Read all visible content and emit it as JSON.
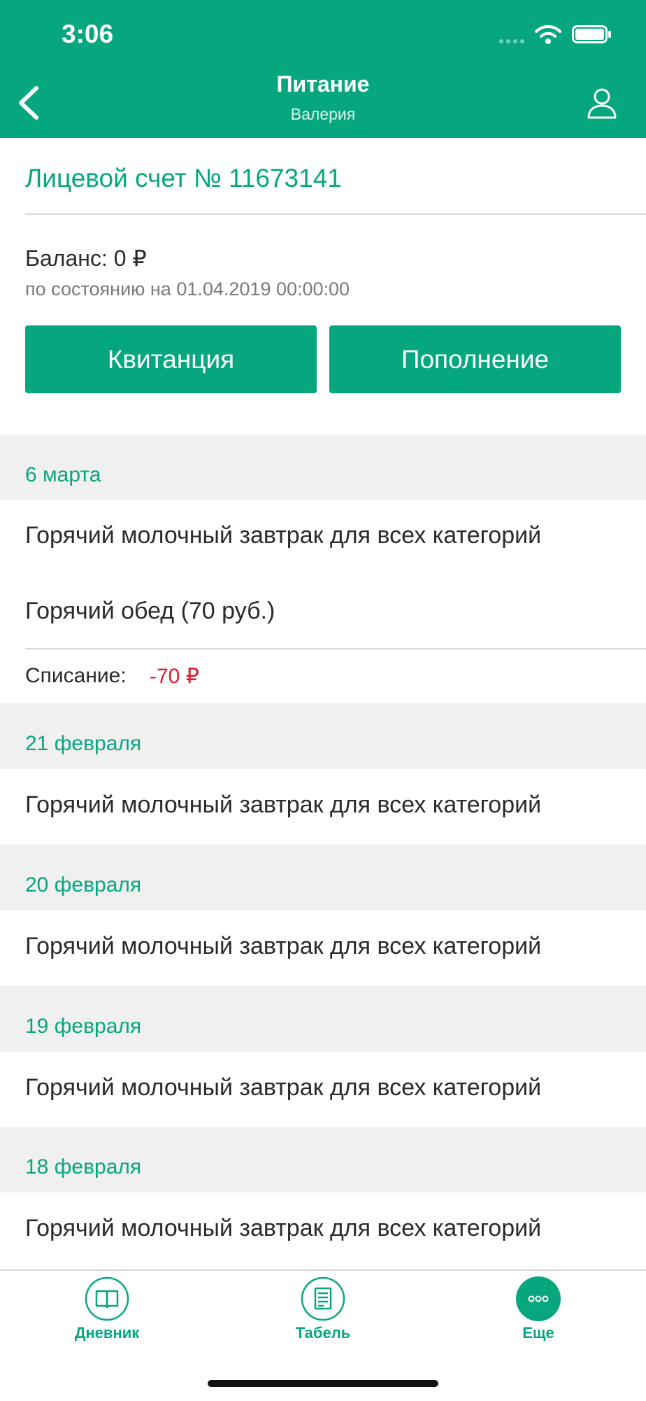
{
  "status_bar": {
    "time": "3:06"
  },
  "header": {
    "title": "Питание",
    "subtitle": "Валерия"
  },
  "account": {
    "title": "Лицевой счет № 11673141",
    "balance": "Баланс: 0 ₽",
    "balance_date": "по состоянию на 01.04.2019 00:00:00"
  },
  "buttons": {
    "receipt": "Квитанция",
    "topup": "Пополнение"
  },
  "days": [
    {
      "date": "6 марта",
      "items": [
        "Горячий молочный завтрак для всех категорий",
        "Горячий обед (70 руб.)"
      ],
      "writeoff_label": "Списание:",
      "writeoff_value": "-70 ₽"
    },
    {
      "date": "21 февраля",
      "items": [
        "Горячий молочный завтрак для всех категорий"
      ]
    },
    {
      "date": "20 февраля",
      "items": [
        "Горячий молочный завтрак для всех категорий"
      ]
    },
    {
      "date": "19 февраля",
      "items": [
        "Горячий молочный завтрак для всех категорий"
      ]
    },
    {
      "date": "18 февраля",
      "items": [
        "Горячий молочный завтрак для всех категорий"
      ]
    }
  ],
  "tabbar": {
    "items": [
      {
        "label": "Дневник",
        "icon": "book-icon"
      },
      {
        "label": "Табель",
        "icon": "report-icon"
      },
      {
        "label": "Еще",
        "icon": "more-icon",
        "active": true
      }
    ]
  },
  "colors": {
    "accent": "#06a77f",
    "negative": "#e21b2c",
    "section_bg": "#f0f0f0"
  }
}
